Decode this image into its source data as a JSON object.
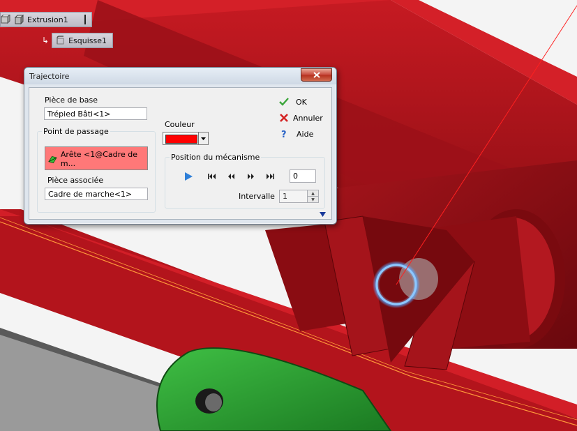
{
  "feature_tree": {
    "extrusion_label": "Extrusion1",
    "sketch_label": "Esquisse1"
  },
  "dialog": {
    "title": "Trajectoire",
    "base_part_label": "Pièce de base",
    "base_part_value": "Trépied Bâti<1>",
    "pass_point_group": "Point de passage",
    "pass_point_item": "Arête <1@Cadre de m...",
    "associated_part_label": "Pièce associée",
    "associated_part_value": "Cadre de marche<1>",
    "ok_label": "OK",
    "cancel_label": "Annuler",
    "help_label": "Aide",
    "color_label": "Couleur",
    "color_value": "#ff0000",
    "mechanism_group": "Position du mécanisme",
    "position_value": "0",
    "interval_label": "Intervalle",
    "interval_value": "1"
  },
  "colors": {
    "part_red": "#b3121a",
    "selection_highlight": "#ff7878",
    "trajectory_line": "#ff2020",
    "green_part": "#2fa335"
  },
  "icons": {
    "ok": "check-icon",
    "cancel": "x-icon",
    "help": "question-icon",
    "play": "play-icon",
    "first": "skip-first-icon",
    "prev": "rewind-icon",
    "next": "fast-forward-icon",
    "last": "skip-last-icon"
  }
}
